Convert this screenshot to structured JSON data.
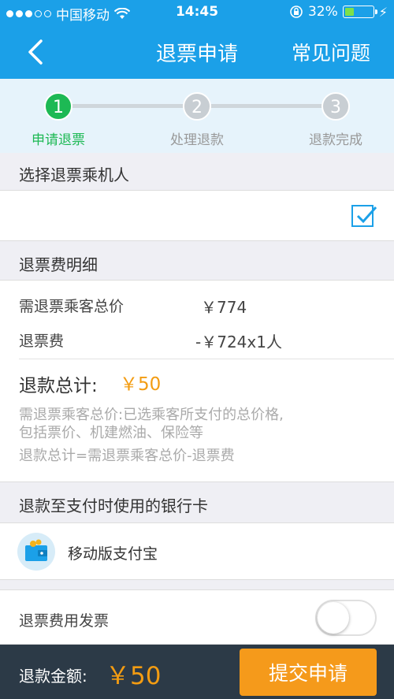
{
  "status_bar": {
    "carrier": "中国移动",
    "time": "14:45",
    "battery": "32%",
    "battery_level": 0.32
  },
  "nav": {
    "title": "退票申请",
    "faq": "常见问题"
  },
  "steps": [
    {
      "number": "1",
      "label": "申请退票"
    },
    {
      "number": "2",
      "label": "处理退款"
    },
    {
      "number": "3",
      "label": "退款完成"
    }
  ],
  "passenger_section": {
    "title": "选择退票乘机人",
    "checked": true
  },
  "fee_section": {
    "title": "退票费明细",
    "total_price_label": "需退票乘客总价",
    "total_price_value": "￥774",
    "fee_label": "退票费",
    "fee_value": "-￥724x1人",
    "refund_total_label": "退款总计:",
    "refund_total_value": "￥50",
    "note_line1": "需退票乘客总价:已选乘客所支付的总价格,",
    "note_line2": "包括票价、机建燃油、保险等",
    "note_line3": "退款总计=需退票乘客总价-退票费"
  },
  "bank_section": {
    "title": "退款至支付时使用的银行卡",
    "method": "移动版支付宝"
  },
  "invoice": {
    "label": "退票费用发票",
    "enabled": false
  },
  "footer": {
    "amount_label": "退款金额:",
    "amount_value": "￥50",
    "submit_label": "提交申请"
  },
  "colors": {
    "brand_blue": "#1ba0e8",
    "step_active": "#1db954",
    "accent_orange": "#f39c12",
    "footer_bg": "#2c3a47"
  }
}
